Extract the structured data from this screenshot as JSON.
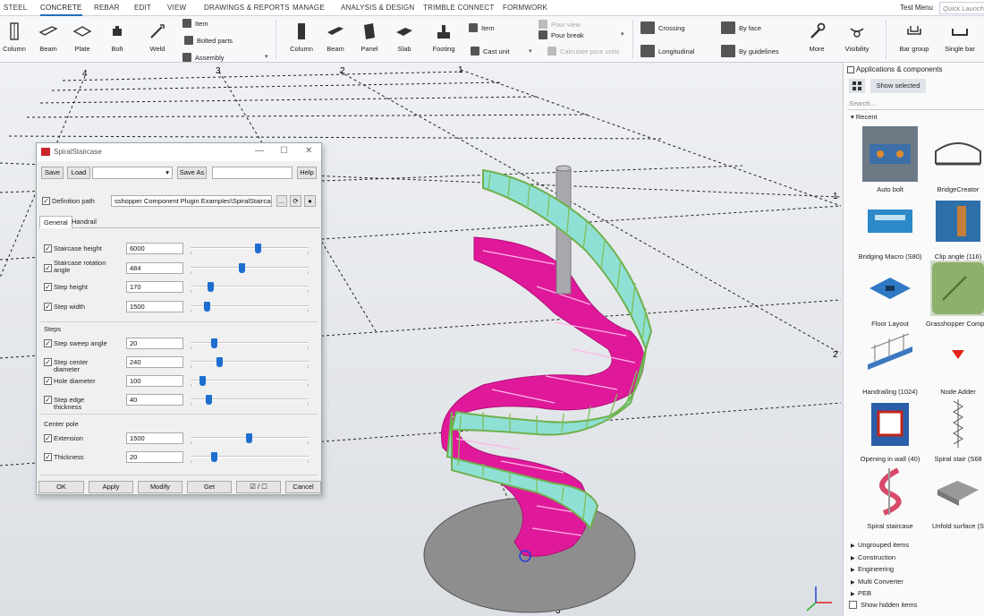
{
  "menubar": {
    "tabs": [
      "STEEL",
      "CONCRETE",
      "REBAR",
      "EDIT",
      "VIEW",
      "DRAWINGS & REPORTS",
      "MANAGE",
      "ANALYSIS & DESIGN",
      "TRIMBLE CONNECT",
      "FORMWORK"
    ],
    "active_tab": "CONCRETE",
    "test_menu": "Test Menu",
    "quick_launch_placeholder": "Quick Launch"
  },
  "ribbon": {
    "steel": {
      "column": "Column",
      "beam": "Beam",
      "plate": "Plate",
      "bolt": "Bolt",
      "weld": "Weld",
      "item": "Item",
      "bolted_parts": "Bolted parts",
      "assembly": "Assembly"
    },
    "concrete": {
      "column": "Column",
      "beam": "Beam",
      "panel": "Panel",
      "slab": "Slab",
      "footing": "Footing",
      "item": "Item",
      "cast_unit": "Cast unit",
      "pour_view": "Pour view",
      "pour_break": "Pour break",
      "calculate_pour_units": "Calculate pour units"
    },
    "rebar": {
      "crossing": "Crossing",
      "longitudinal": "Longitudinal",
      "by_face": "By face",
      "by_guidelines": "By guidelines"
    },
    "more": "More",
    "visibility": "Visibility",
    "bar_group": "Bar group",
    "single_bar": "Single bar"
  },
  "viewport": {
    "grid_labels_top": [
      "4",
      "3",
      "2",
      "1"
    ],
    "grid_labels_right": [
      "1",
      "2"
    ],
    "grid_label_bottom": "3"
  },
  "dialog": {
    "title": "SpiralStaircase",
    "save": "Save",
    "load": "Load",
    "save_as": "Save As",
    "help": "Help",
    "definition_path_label": "Definition path",
    "definition_path_value": "sshopper Component Plugin Examples\\SpiralStaircase.gh",
    "browse": "...",
    "tabs": [
      "General",
      "Handrail"
    ],
    "fields_top": [
      {
        "label": "Staircase height",
        "value": "6000",
        "slider": 0.57
      },
      {
        "label": "Staircase rotation angle",
        "value": "484",
        "slider": 0.43
      },
      {
        "label": "Step height",
        "value": "170",
        "slider": 0.17
      },
      {
        "label": "Step width",
        "value": "1500",
        "slider": 0.14
      }
    ],
    "steps_section": "Steps",
    "fields_steps": [
      {
        "label": "Step sweep angle",
        "value": "20",
        "slider": 0.2
      },
      {
        "label": "Step center diameter",
        "value": "240",
        "slider": 0.24
      },
      {
        "label": "Hole diameter",
        "value": "100",
        "slider": 0.1
      },
      {
        "label": "Step edge thickness",
        "value": "40",
        "slider": 0.15
      }
    ],
    "pole_section": "Center pole",
    "fields_pole": [
      {
        "label": "Extension",
        "value": "1500",
        "slider": 0.49
      },
      {
        "label": "Thickness",
        "value": "20",
        "slider": 0.2
      }
    ],
    "ok": "OK",
    "apply": "Apply",
    "modify": "Modify",
    "get": "Get",
    "toggle": "☑ / ☐",
    "cancel": "Cancel"
  },
  "panel": {
    "title": "Applications & components",
    "show_selected": "Show selected",
    "search_placeholder": "Search...",
    "recent": "Recent",
    "components": [
      "Auto bolt",
      "BridgeCreator",
      "Bridging Macro (S80)",
      "Clip angle (116)",
      "Floor Layout",
      "Grasshopper Component",
      "Handrailing (1024)",
      "Node Adder",
      "Opening in wall (40)",
      "Spiral stair (S68",
      "Spiral staircase",
      "Unfold surface (S"
    ],
    "tree": [
      "Ungrouped items",
      "Construction",
      "Engineering",
      "Multi Converter",
      "PEB"
    ],
    "show_hidden": "Show hidden items"
  },
  "colors": {
    "accent": "#1e6fb8",
    "stair_pink": "#e0199a",
    "railing_green": "#7fbf5a",
    "glass_cyan": "#8fe0d4",
    "slider_blue": "#1c6fd0"
  }
}
